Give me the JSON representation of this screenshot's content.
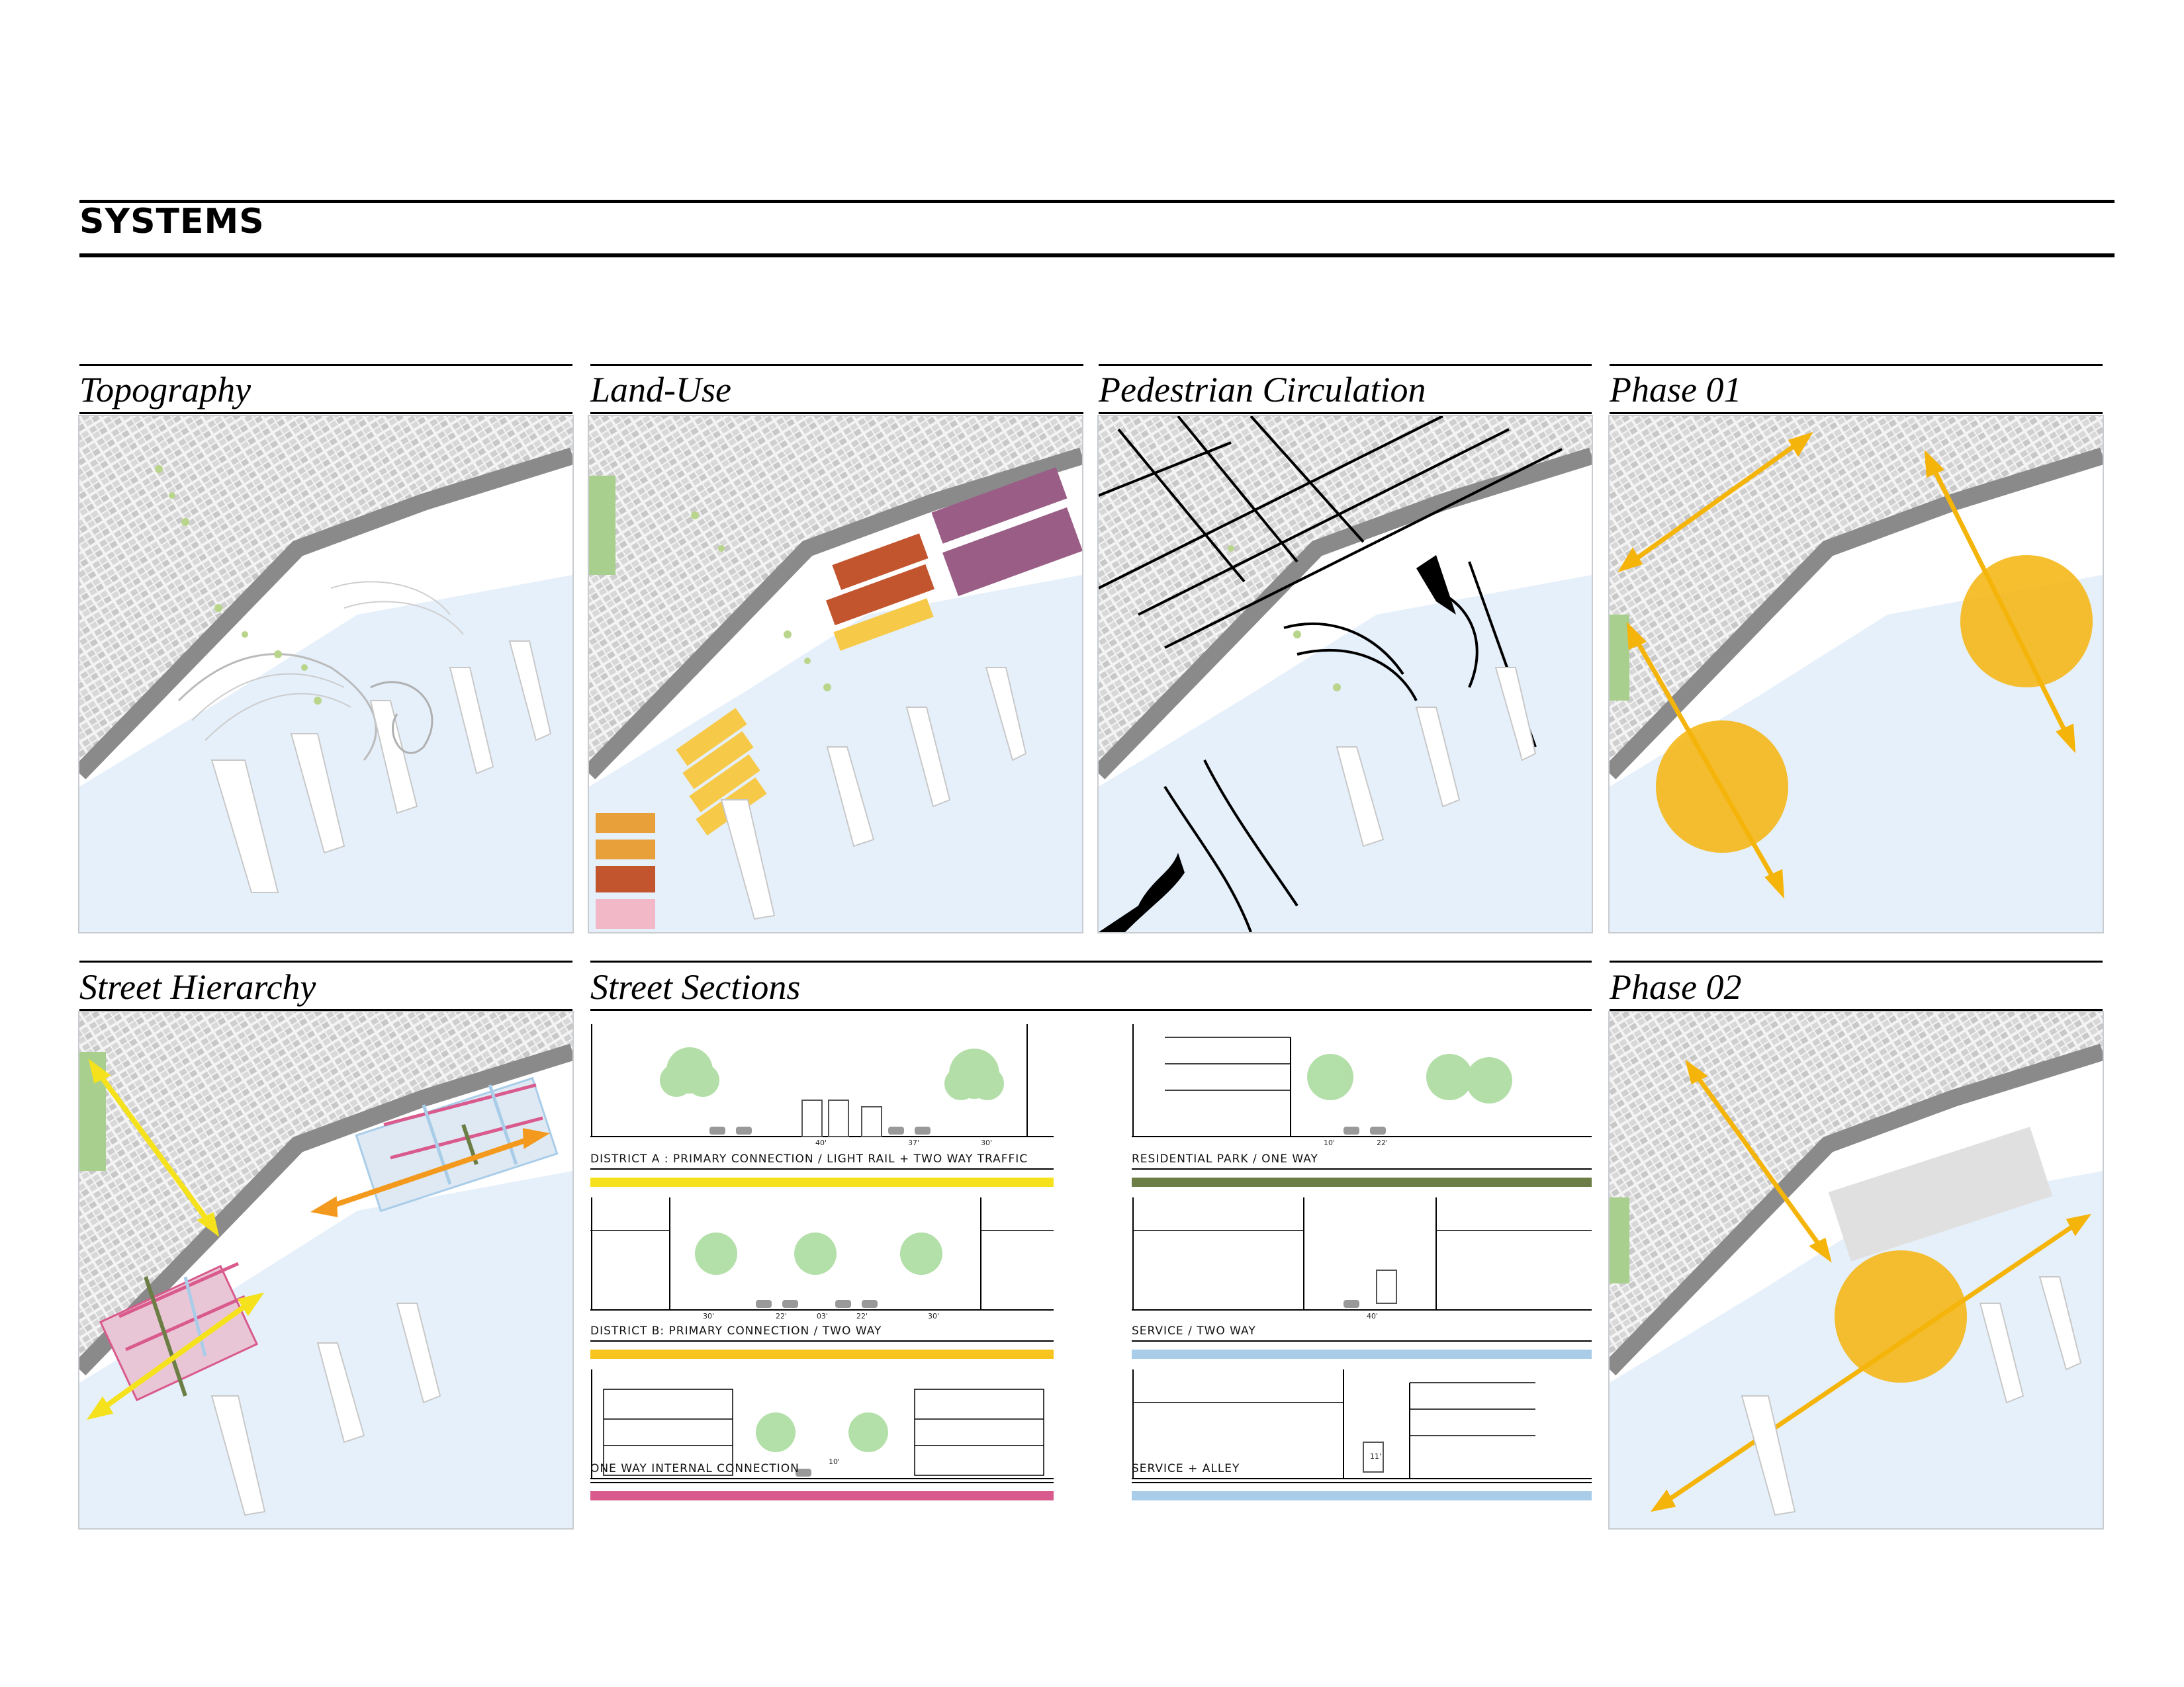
{
  "page": {
    "title": "SYSTEMS"
  },
  "panels": {
    "topography": {
      "title": "Topography"
    },
    "land_use": {
      "title": "Land-Use"
    },
    "pedestrian": {
      "title": "Pedestrian Circulation"
    },
    "phase01": {
      "title": "Phase 01"
    },
    "street_hierarchy": {
      "title": "Street Hierarchy"
    },
    "street_sections": {
      "title": "Street Sections"
    },
    "phase02": {
      "title": "Phase 02"
    }
  },
  "sections": [
    {
      "label": "DISTRICT A : PRIMARY CONNECTION / LIGHT RAIL + TWO WAY TRAFFIC",
      "color": "#f5e21c",
      "dims": [
        "40'",
        "37'",
        "30'"
      ]
    },
    {
      "label": "RESIDENTIAL PARK / ONE WAY",
      "color": "#6c7d45",
      "dims": [
        "10'",
        "22'"
      ]
    },
    {
      "label": "DISTRICT B: PRIMARY CONNECTION / TWO WAY",
      "color": "#f7c51e",
      "dims": [
        "30'",
        "22'",
        "03'",
        "22'",
        "30'"
      ]
    },
    {
      "label": "SERVICE /  TWO WAY",
      "color": "#a9cde9",
      "dims": [
        "40'"
      ]
    },
    {
      "label": "ONE WAY INTERNAL CONNECTION",
      "color": "#d95a8c",
      "dims": [
        "10'"
      ]
    },
    {
      "label": "SERVICE + ALLEY",
      "color": "#a9cde9",
      "dims": [
        "11'"
      ]
    }
  ],
  "colors": {
    "water": "#e6f0fb",
    "blocks": "#d4d4d4",
    "highway": "#8a8a8a",
    "vegetation": "#b9d58b",
    "park": "#a8cf8e",
    "landuse_yellow": "#f7c948",
    "landuse_orange": "#e8a03a",
    "landuse_rust": "#c2542e",
    "landuse_purple": "#9a5e86",
    "landuse_pink": "#f3b8c7",
    "phase_circle": "#f5b40a",
    "hierarchy_pink": "#d95a8c",
    "hierarchy_blue": "#a9cde9",
    "hierarchy_green": "#6c7d45",
    "hierarchy_orange": "#f39a1e",
    "hierarchy_yellow": "#f5e21c"
  }
}
